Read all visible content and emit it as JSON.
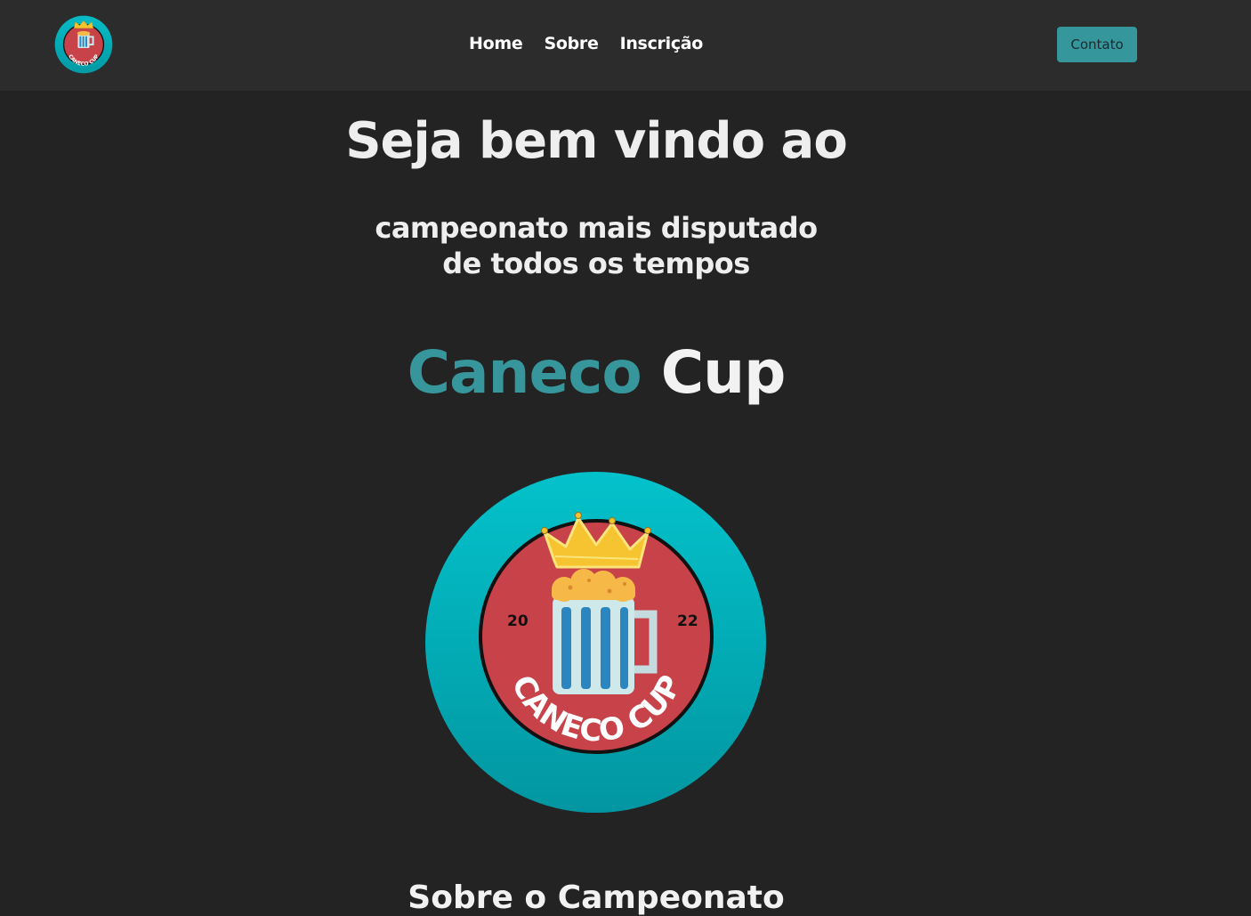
{
  "nav": {
    "logo_text": "CANECO CUP",
    "links": [
      {
        "label": "Home"
      },
      {
        "label": "Sobre"
      },
      {
        "label": "Inscrição"
      }
    ],
    "contact_label": "Contato"
  },
  "hero": {
    "title": "Seja bem vindo ao",
    "subtitle_line1": "campeonato mais disputado",
    "subtitle_line2": "de todos os tempos",
    "brand_first": "Caneco",
    "brand_second": "Cup"
  },
  "logo": {
    "year_left": "20",
    "year_right": "22",
    "ring_text": "CANECO CUP"
  },
  "next_section": {
    "heading": "Sobre o Campeonato"
  },
  "colors": {
    "accent": "#36969b",
    "background": "#232323",
    "navbar": "#2c2c2c",
    "logo_red": "#c8424a",
    "logo_teal": "#03b3bf"
  }
}
